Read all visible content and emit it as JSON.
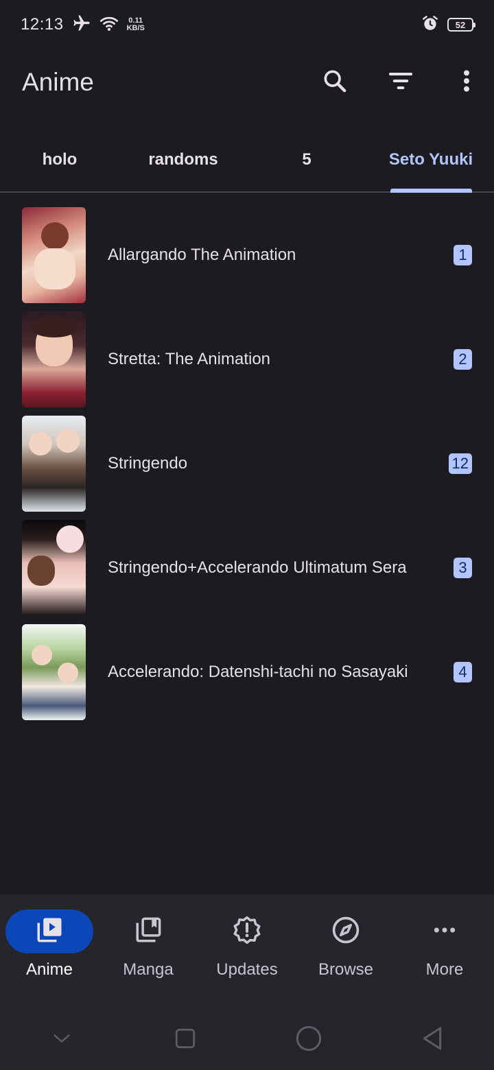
{
  "status_bar": {
    "time": "12:13",
    "net_speed_value": "0.11",
    "net_speed_unit": "KB/S",
    "battery": "52"
  },
  "app_bar": {
    "title": "Anime"
  },
  "tabs": [
    {
      "label": "holo",
      "active": false
    },
    {
      "label": "randoms",
      "active": false
    },
    {
      "label": "5",
      "active": false
    },
    {
      "label": "Seto Yuuki",
      "active": true
    }
  ],
  "items": [
    {
      "title": "Allargando The Animation",
      "count": "1"
    },
    {
      "title": "Stretta: The Animation",
      "count": "2"
    },
    {
      "title": "Stringendo",
      "count": "12"
    },
    {
      "title": "Stringendo+Accelerando Ultimatum Sera",
      "count": "3"
    },
    {
      "title": "Accelerando: Datenshi-tachi no Sasayaki",
      "count": "4"
    }
  ],
  "bottom_nav": [
    {
      "label": "Anime",
      "icon": "play-library-icon",
      "active": true
    },
    {
      "label": "Manga",
      "icon": "book-library-icon",
      "active": false
    },
    {
      "label": "Updates",
      "icon": "alert-badge-icon",
      "active": false
    },
    {
      "label": "Browse",
      "icon": "compass-icon",
      "active": false
    },
    {
      "label": "More",
      "icon": "more-horizontal-icon",
      "active": false
    }
  ],
  "colors": {
    "background": "#1c1b20",
    "accent": "#b3c5ff",
    "nav_active_pill": "#0b47b8",
    "badge_text": "#0f2a6b"
  }
}
